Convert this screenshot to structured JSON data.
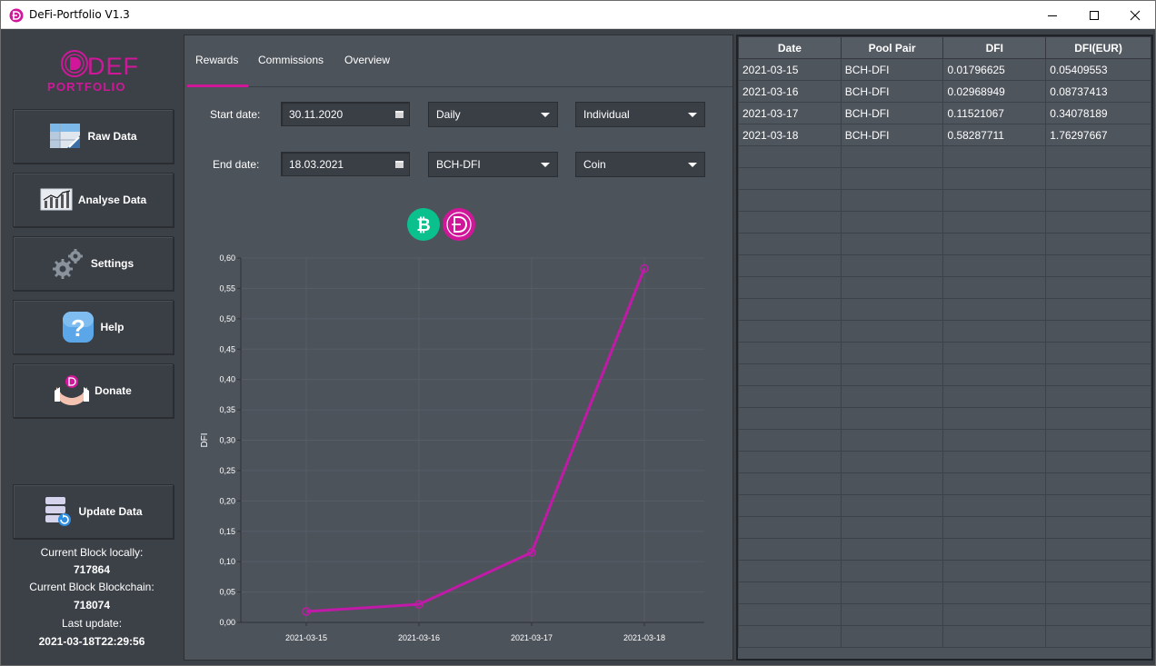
{
  "window": {
    "title": "DeFi-Portfolio V1.3",
    "controls": [
      "minimize",
      "maximize",
      "close"
    ]
  },
  "sidebar": {
    "logo": {
      "line1": "DEFI",
      "line2": "PORTFOLIO",
      "color": "#d0179a"
    },
    "nav": [
      {
        "label": "Raw Data",
        "icon": "spreadsheet-icon"
      },
      {
        "label": "Analyse Data",
        "icon": "line-chart-icon"
      },
      {
        "label": "Settings",
        "icon": "gears-icon"
      },
      {
        "label": "Help",
        "icon": "question-icon"
      },
      {
        "label": "Donate",
        "icon": "donate-hands-icon"
      }
    ],
    "update": {
      "label": "Update Data",
      "icon": "database-refresh-icon"
    },
    "status": {
      "local_label": "Current Block locally:",
      "local_value": "717864",
      "chain_label": "Current Block Blockchain:",
      "chain_value": "718074",
      "update_label": "Last update:",
      "update_value": "2021-03-18T22:29:56"
    }
  },
  "center": {
    "tabs": [
      {
        "label": "Rewards",
        "active": true
      },
      {
        "label": "Commissions",
        "active": false
      },
      {
        "label": "Overview",
        "active": false
      }
    ],
    "filters": {
      "start_label": "Start date:",
      "start_value": "30.11.2020",
      "end_label": "End date:",
      "end_value": "18.03.2021",
      "interval": "Daily",
      "mode": "Individual",
      "pool": "BCH-DFI",
      "unit": "Coin"
    },
    "coin_icons": [
      "bitcoin-cash-icon",
      "defichain-icon"
    ]
  },
  "chart_data": {
    "type": "line",
    "x": [
      "2021-03-15",
      "2021-03-16",
      "2021-03-17",
      "2021-03-18"
    ],
    "series": [
      {
        "values": [
          0.01796625,
          0.02968949,
          0.11521067,
          0.58287711
        ]
      }
    ],
    "ylabel": "DFI",
    "xlabel": "",
    "ylim": [
      0,
      0.6
    ],
    "yticks": [
      "0,00",
      "0,05",
      "0,10",
      "0,15",
      "0,20",
      "0,25",
      "0,30",
      "0,35",
      "0,40",
      "0,45",
      "0,50",
      "0,55",
      "0,60"
    ],
    "grid": true,
    "line_color": "#c21aa8"
  },
  "table": {
    "headers": [
      "Date",
      "Pool Pair",
      "DFI",
      "DFI(EUR)"
    ],
    "rows": [
      [
        "2021-03-15",
        "BCH-DFI",
        "0.01796625",
        "0.05409553"
      ],
      [
        "2021-03-16",
        "BCH-DFI",
        "0.02968949",
        "0.08737413"
      ],
      [
        "2021-03-17",
        "BCH-DFI",
        "0.11521067",
        "0.34078189"
      ],
      [
        "2021-03-18",
        "BCH-DFI",
        "0.58287711",
        "1.76297667"
      ]
    ]
  },
  "colors": {
    "accent": "#d0179a",
    "background": "#3c4148",
    "panel": "#4d535b"
  }
}
